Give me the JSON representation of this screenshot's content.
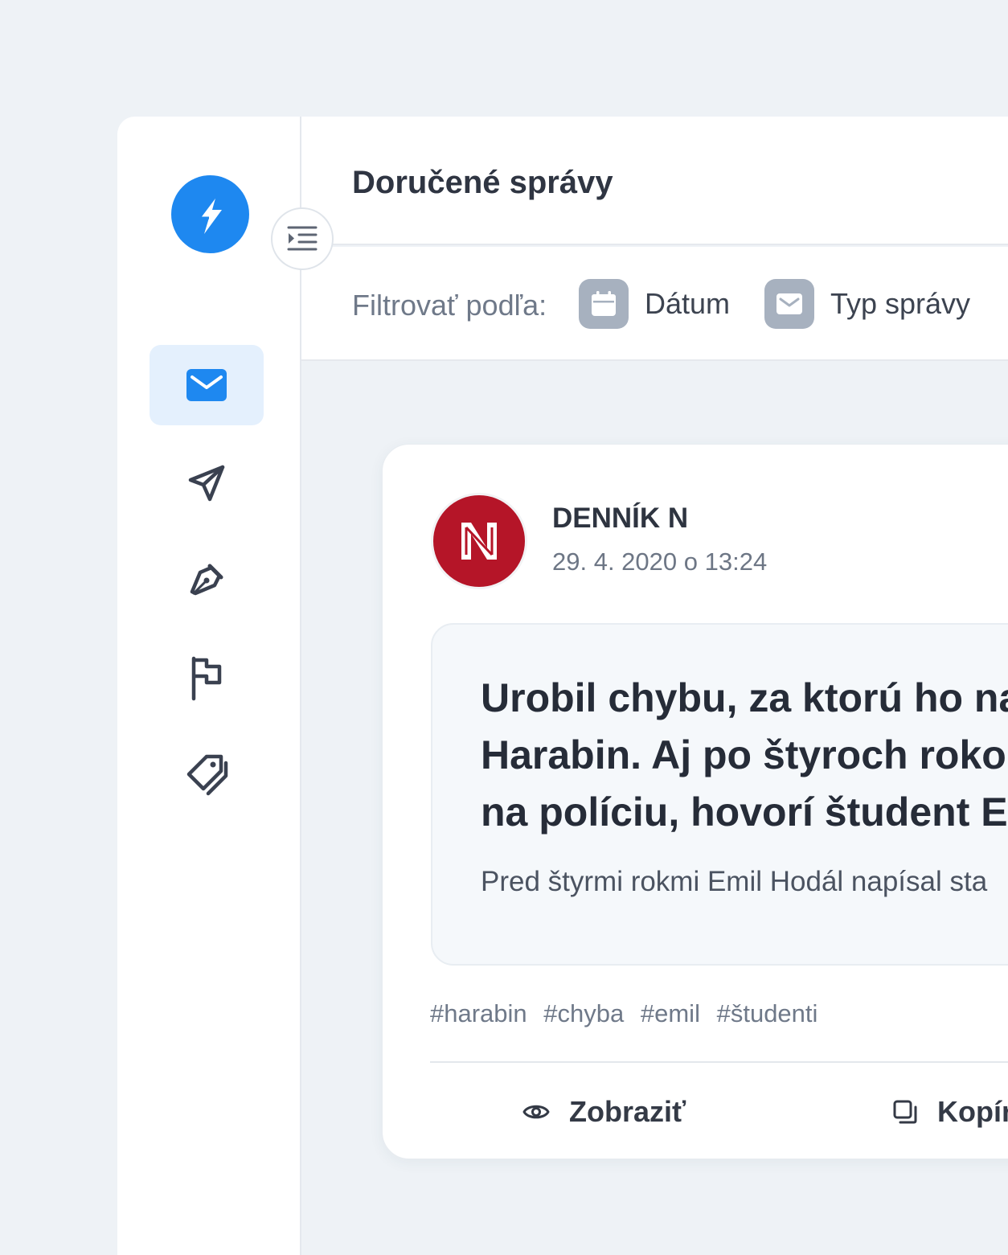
{
  "app": {
    "logo_icon": "lightning-bolt-icon",
    "accent_color": "#1e88f0"
  },
  "sidebar": {
    "items": [
      {
        "icon": "envelope-icon",
        "active": true
      },
      {
        "icon": "paper-plane-icon",
        "active": false
      },
      {
        "icon": "pen-nib-icon",
        "active": false
      },
      {
        "icon": "flag-icon",
        "active": false
      },
      {
        "icon": "tags-icon",
        "active": false
      }
    ],
    "collapse_icon": "indent-icon"
  },
  "header": {
    "title": "Doručené správy"
  },
  "filters": {
    "label": "Filtrovať podľa:",
    "chips": [
      {
        "icon": "calendar-icon",
        "label": "Dátum"
      },
      {
        "icon": "envelope-icon",
        "label": "Typ správy"
      }
    ]
  },
  "message": {
    "sender": "DENNÍK N",
    "date": "29. 4. 2020 o 13:24",
    "avatar_color": "#b51528",
    "headline_lines": [
      "Urobil chybu, za ktorú ho na",
      "Harabin. Aj po štyroch roko",
      "na políciu, hovorí študent E"
    ],
    "excerpt": "Pred štyrmi rokmi Emil Hodál napísal sta",
    "tags": [
      "#harabin",
      "#chyba",
      "#emil",
      "#študenti"
    ],
    "actions": [
      {
        "icon": "eye-icon",
        "label": "Zobraziť"
      },
      {
        "icon": "copy-icon",
        "label": "Kopír"
      }
    ]
  }
}
